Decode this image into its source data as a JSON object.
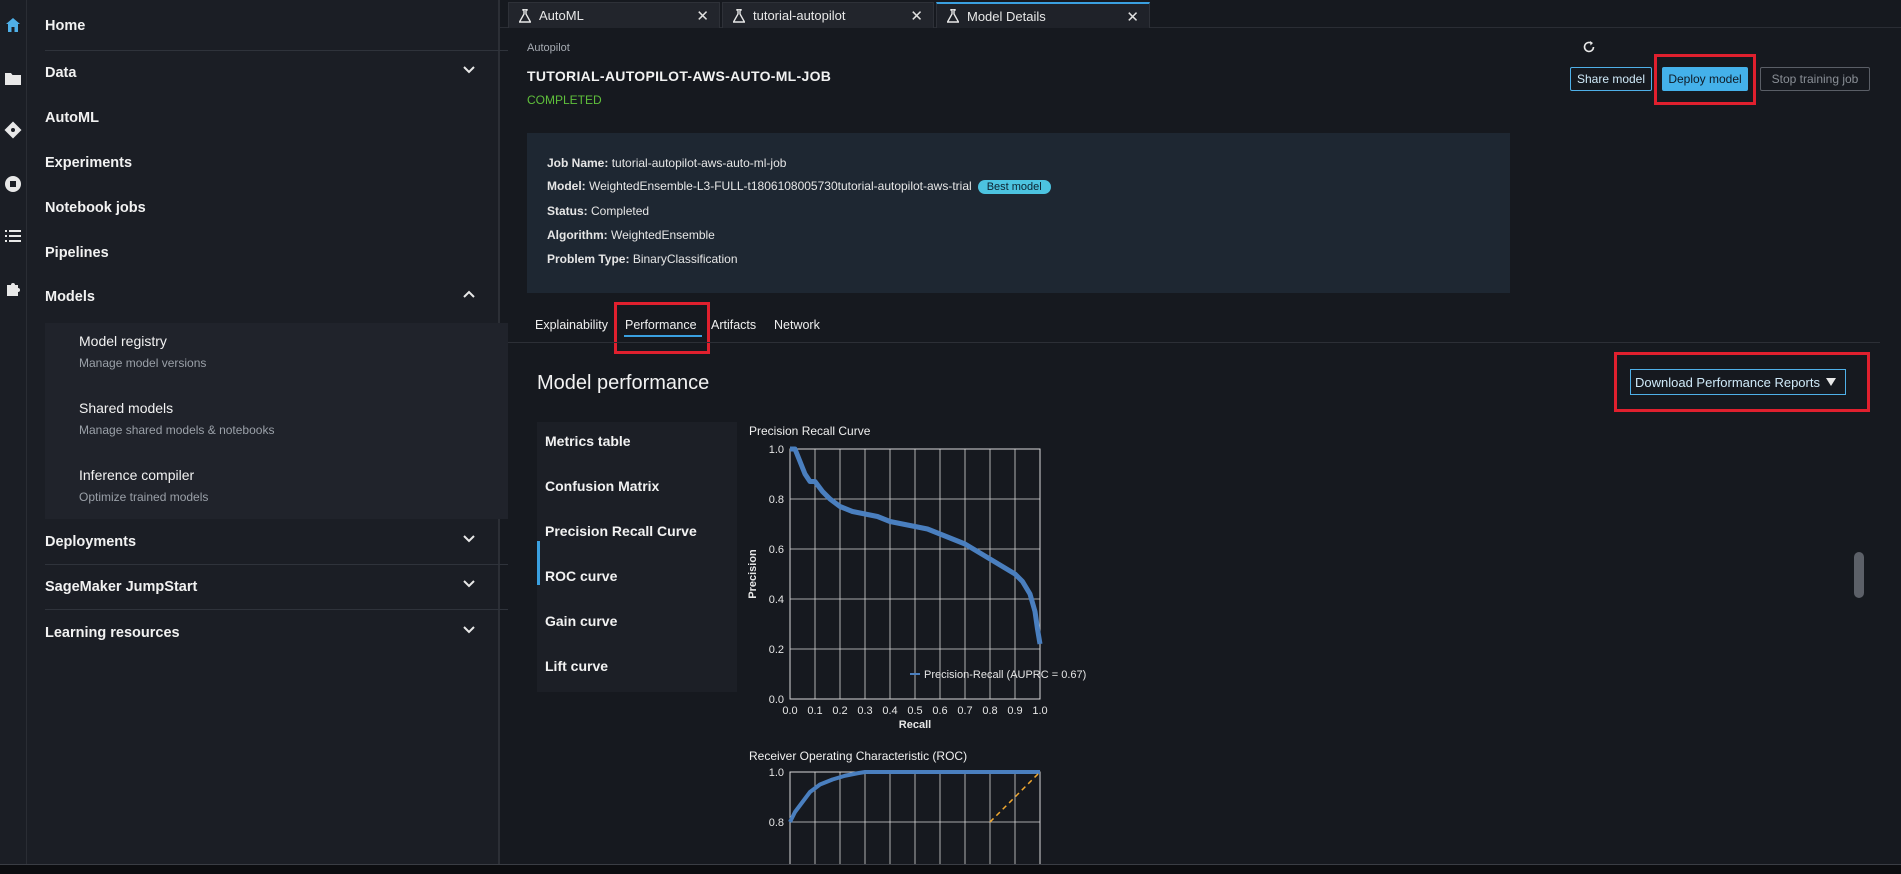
{
  "sidebar": {
    "items": [
      {
        "label": "Home",
        "chevron": ""
      },
      {
        "label": "Data",
        "chevron": "down"
      },
      {
        "label": "AutoML",
        "chevron": ""
      },
      {
        "label": "Experiments",
        "chevron": ""
      },
      {
        "label": "Notebook jobs",
        "chevron": ""
      },
      {
        "label": "Pipelines",
        "chevron": ""
      },
      {
        "label": "Models",
        "chevron": "up"
      },
      {
        "label": "Deployments",
        "chevron": "down"
      },
      {
        "label": "SageMaker JumpStart",
        "chevron": "down"
      },
      {
        "label": "Learning resources",
        "chevron": "down"
      }
    ],
    "models_sub": [
      {
        "title": "Model registry",
        "desc": "Manage model versions"
      },
      {
        "title": "Shared models",
        "desc": "Manage shared models & notebooks"
      },
      {
        "title": "Inference compiler",
        "desc": "Optimize trained models"
      }
    ]
  },
  "tabs": [
    {
      "label": "AutoML"
    },
    {
      "label": "tutorial-autopilot"
    },
    {
      "label": "Model Details"
    }
  ],
  "header": {
    "breadcrumb": "Autopilot",
    "title": "TUTORIAL-AUTOPILOT-AWS-AUTO-ML-JOB",
    "status": "COMPLETED",
    "share_label": "Share model",
    "deploy_label": "Deploy model",
    "stop_label": "Stop training job"
  },
  "info": {
    "job_name_label": "Job Name:",
    "job_name": "tutorial-autopilot-aws-auto-ml-job",
    "model_label": "Model:",
    "model": "WeightedEnsemble-L3-FULL-t1806108005730tutorial-autopilot-aws-trial",
    "best_badge": "Best model",
    "status_label": "Status:",
    "status": "Completed",
    "algorithm_label": "Algorithm:",
    "algorithm": "WeightedEnsemble",
    "problem_label": "Problem Type:",
    "problem": "BinaryClassification"
  },
  "subtabs": [
    "Explainability",
    "Performance",
    "Artifacts",
    "Network"
  ],
  "performance": {
    "title": "Model performance",
    "download_label": "Download Performance Reports",
    "metrics": [
      "Metrics table",
      "Confusion Matrix",
      "Precision Recall Curve",
      "ROC curve",
      "Gain curve",
      "Lift curve"
    ]
  },
  "colors": {
    "accent": "#3aa0e0",
    "highlight": "#e0202e",
    "success": "#5fbf3b",
    "series": "#4a7fbf",
    "diagonal": "#f0a830"
  },
  "chart_data": [
    {
      "type": "line",
      "title": "Precision Recall Curve",
      "xlabel": "Recall",
      "ylabel": "Precision",
      "xlim": [
        0,
        1
      ],
      "ylim": [
        0,
        1
      ],
      "xticks": [
        "0.0",
        "0.1",
        "0.2",
        "0.3",
        "0.4",
        "0.5",
        "0.6",
        "0.7",
        "0.8",
        "0.9",
        "1.0"
      ],
      "yticks": [
        "0.0",
        "0.2",
        "0.4",
        "0.6",
        "0.8",
        "1.0"
      ],
      "grid": true,
      "legend": "bottom-right",
      "series": [
        {
          "name": "Precision-Recall (AUPRC = 0.67)",
          "x": [
            0.0,
            0.02,
            0.04,
            0.06,
            0.08,
            0.1,
            0.13,
            0.16,
            0.2,
            0.25,
            0.3,
            0.35,
            0.4,
            0.45,
            0.5,
            0.55,
            0.6,
            0.65,
            0.7,
            0.75,
            0.8,
            0.85,
            0.9,
            0.93,
            0.96,
            0.98,
            0.99,
            1.0
          ],
          "y": [
            1.0,
            1.0,
            0.95,
            0.9,
            0.87,
            0.87,
            0.83,
            0.8,
            0.77,
            0.75,
            0.74,
            0.73,
            0.71,
            0.7,
            0.69,
            0.68,
            0.66,
            0.64,
            0.62,
            0.59,
            0.56,
            0.53,
            0.5,
            0.47,
            0.42,
            0.35,
            0.28,
            0.22
          ]
        }
      ]
    },
    {
      "type": "line",
      "title": "Receiver Operating Characteristic (ROC)",
      "xlim": [
        0,
        1
      ],
      "ylim": [
        0.8,
        1.0
      ],
      "yticks": [
        "0.8",
        "1.0"
      ],
      "grid": true,
      "series": [
        {
          "x": [
            0.0,
            0.02,
            0.05,
            0.08,
            0.12,
            0.17,
            0.22,
            0.27,
            0.3,
            0.4,
            0.6,
            0.8,
            1.0
          ],
          "y": [
            0.8,
            0.84,
            0.88,
            0.92,
            0.95,
            0.97,
            0.985,
            0.995,
            1.0,
            1.0,
            1.0,
            1.0,
            1.0
          ]
        },
        {
          "x": [
            0.0,
            1.0
          ],
          "y": [
            0.0,
            1.0
          ]
        }
      ]
    }
  ]
}
